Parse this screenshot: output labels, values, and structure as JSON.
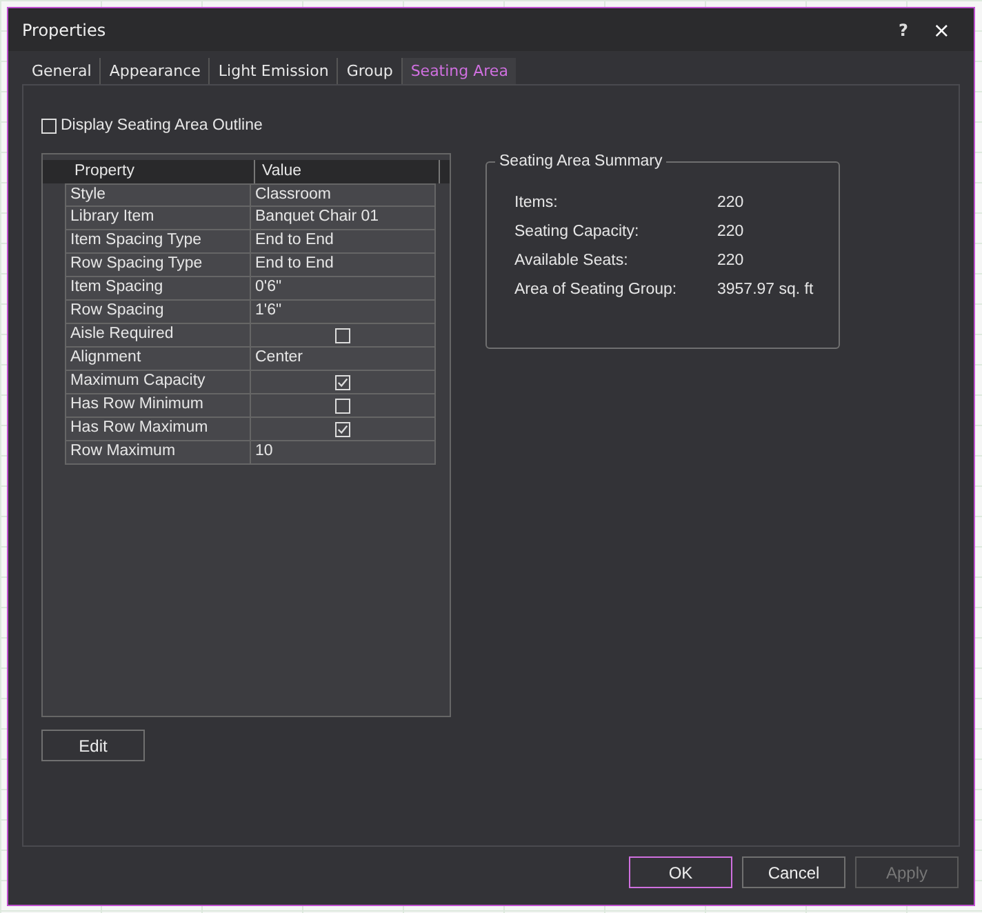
{
  "window": {
    "title": "Properties",
    "help": "?",
    "close": "×"
  },
  "tabs": [
    {
      "label": "General",
      "selected": false
    },
    {
      "label": "Appearance",
      "selected": false
    },
    {
      "label": "Light Emission",
      "selected": false
    },
    {
      "label": "Group",
      "selected": false
    },
    {
      "label": "Seating Area",
      "selected": true
    }
  ],
  "outline_option": {
    "label": "Display Seating Area Outline",
    "checked": false
  },
  "grid": {
    "columns": [
      "Property",
      "Value"
    ],
    "rows": [
      {
        "name": "Style",
        "kind": "text",
        "value": "Classroom"
      },
      {
        "name": "Library Item",
        "kind": "text",
        "value": "Banquet Chair 01"
      },
      {
        "name": "Item Spacing Type",
        "kind": "text",
        "value": "End to End"
      },
      {
        "name": "Row Spacing Type",
        "kind": "text",
        "value": "End to End"
      },
      {
        "name": "Item Spacing",
        "kind": "text",
        "value": "0'6\""
      },
      {
        "name": "Row Spacing",
        "kind": "text",
        "value": "1'6\""
      },
      {
        "name": "Aisle Required",
        "kind": "check",
        "checked": false
      },
      {
        "name": "Alignment",
        "kind": "text",
        "value": "Center"
      },
      {
        "name": "Maximum Capacity",
        "kind": "check",
        "checked": true
      },
      {
        "name": "Has Row Minimum",
        "kind": "check",
        "checked": false
      },
      {
        "name": "Has Row Maximum",
        "kind": "check",
        "checked": true
      },
      {
        "name": "Row Maximum",
        "kind": "text",
        "value": "10"
      }
    ]
  },
  "summary": {
    "title": "Seating Area Summary",
    "items": [
      {
        "label": "Items:",
        "value": "220"
      },
      {
        "label": "Seating Capacity:",
        "value": "220"
      },
      {
        "label": "Available Seats:",
        "value": "220"
      },
      {
        "label": "Area of Seating Group:",
        "value": "3957.97 sq. ft"
      }
    ]
  },
  "edit_button": "Edit",
  "buttons": [
    {
      "label": "OK",
      "kind": "default",
      "disabled": false
    },
    {
      "label": "Cancel",
      "kind": "normal",
      "disabled": false
    },
    {
      "label": "Apply",
      "kind": "normal",
      "disabled": true
    }
  ]
}
